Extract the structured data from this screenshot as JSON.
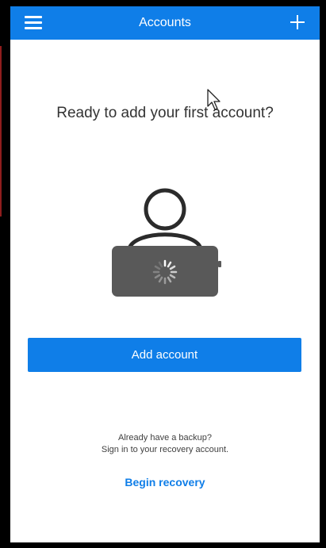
{
  "colors": {
    "accent": "#0f7ee8",
    "frame": "#000000",
    "screen": "#ffffff",
    "illustration": "#595959"
  },
  "header": {
    "title": "Accounts",
    "menu_icon": "menu-icon",
    "add_icon": "plus-icon"
  },
  "main": {
    "heading": "Ready to add your first account?",
    "illustration_icon": "account-laptop-loading-icon",
    "primary_button": "Add account",
    "backup_line_1": "Already have a backup?",
    "backup_line_2": "Sign in to your recovery account.",
    "recovery_link": "Begin recovery"
  },
  "overlay": {
    "cursor_icon": "mouse-cursor-icon"
  }
}
